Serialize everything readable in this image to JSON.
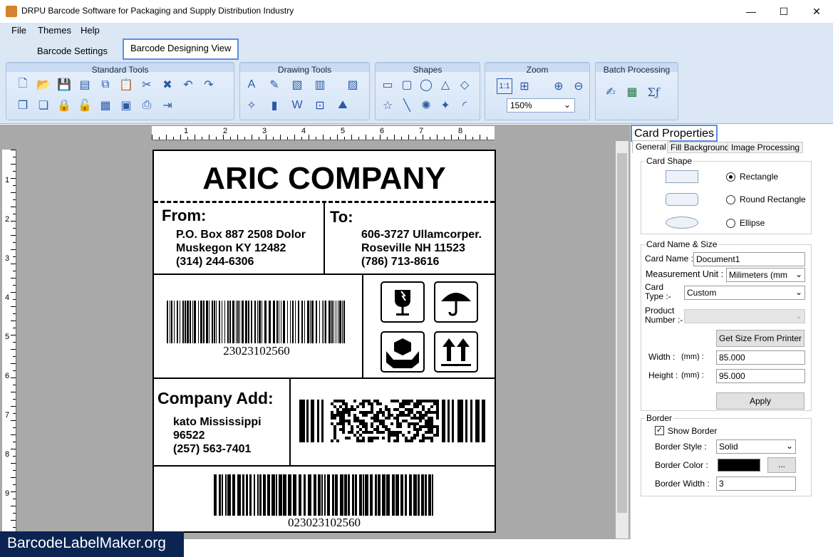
{
  "window": {
    "title": "DRPU Barcode Software for Packaging and Supply Distribution Industry",
    "minimize": "—",
    "maximize": "☐",
    "close": "✕"
  },
  "menu": [
    "File",
    "Themes",
    "Help"
  ],
  "tabs": {
    "settings": "Barcode Settings",
    "designing": "Barcode Designing View"
  },
  "ribbon": {
    "standard": "Standard Tools",
    "drawing": "Drawing Tools",
    "shapes": "Shapes",
    "zoom": "Zoom",
    "zoom_value": "150%",
    "batch": "Batch Processing"
  },
  "ruler": {
    "h": [
      "1",
      "2",
      "3",
      "4",
      "5",
      "6",
      "7",
      "8"
    ],
    "v": [
      "1",
      "2",
      "3",
      "4",
      "5",
      "6",
      "7",
      "8",
      "9"
    ]
  },
  "card": {
    "company": "ARIC COMPANY",
    "from_label": "From:",
    "from_lines": [
      "P.O. Box 887 2508 Dolor",
      "Muskegon KY 12482",
      "(314) 244-6306"
    ],
    "to_label": "To:",
    "to_lines": [
      "606-3727 Ullamcorper.",
      "Roseville NH 11523",
      "(786) 713-8616"
    ],
    "barcode1_text": "23023102560",
    "company_add_label": "Company Add:",
    "add_lines": [
      "kato Mississippi",
      "96522",
      "(257) 563-7401"
    ],
    "barcode3_text": "023023102560"
  },
  "panel": {
    "title": "Card Properties",
    "tabs": [
      "General",
      "Fill Background",
      "Image Processing"
    ],
    "shape_legend": "Card Shape",
    "shapes": [
      "Rectangle",
      "Round Rectangle",
      "Ellipse"
    ],
    "name_legend": "Card  Name & Size",
    "card_name_label": "Card Name :",
    "card_name_value": "Document1",
    "unit_label": "Measurement Unit :",
    "unit_value": "Milimeters (mm",
    "card_type_label": "Card\nType :-",
    "card_type_value": "Custom",
    "product_label": "Product\nNumber :-",
    "get_size_button": "Get Size From Printer",
    "width_label": "Width :",
    "height_label": "Height :",
    "mm_label": "(mm) :",
    "width_value": "85.000",
    "height_value": "95.000",
    "apply_button": "Apply",
    "border_legend": "Border",
    "show_border": "Show Border",
    "border_style_label": "Border Style :",
    "border_style_value": "Solid",
    "border_color_label": "Border Color :",
    "border_color_value": "#000000",
    "ellipsis": "...",
    "border_width_label": "Border Width :",
    "border_width_value": "3"
  },
  "watermark": "BarcodeLabelMaker.org"
}
